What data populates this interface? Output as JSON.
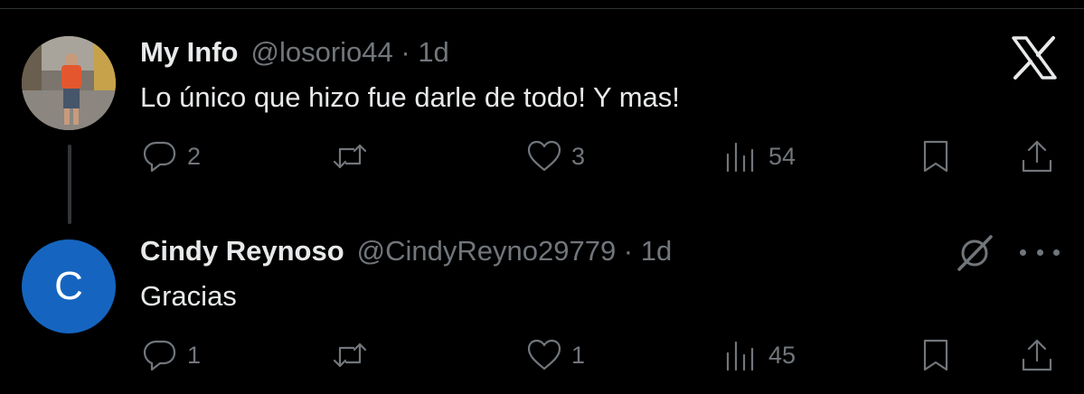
{
  "tweets": [
    {
      "display_name": "My Info",
      "meta": "@losorio44 · 1d",
      "text": "Lo único que hizo fue darle de todo! Y mas!",
      "replies": "2",
      "reposts": "",
      "likes": "3",
      "views": "54"
    },
    {
      "display_name": "Cindy Reynoso",
      "meta": "@CindyReyno29779 · 1d",
      "avatar_letter": "C",
      "text": "Gracias",
      "replies": "1",
      "reposts": "",
      "likes": "1",
      "views": "45"
    }
  ],
  "icons": {
    "reply": "reply-icon",
    "repost": "repost-icon",
    "like": "like-icon",
    "views": "views-icon",
    "bookmark": "bookmark-icon",
    "share": "share-icon",
    "brand": "x-logo-icon",
    "grok": "grok-icon",
    "more": "more-icon"
  },
  "colors": {
    "background": "#000000",
    "text": "#e7e9ea",
    "muted": "#71767b",
    "avatar_bg": "#1565c0"
  }
}
